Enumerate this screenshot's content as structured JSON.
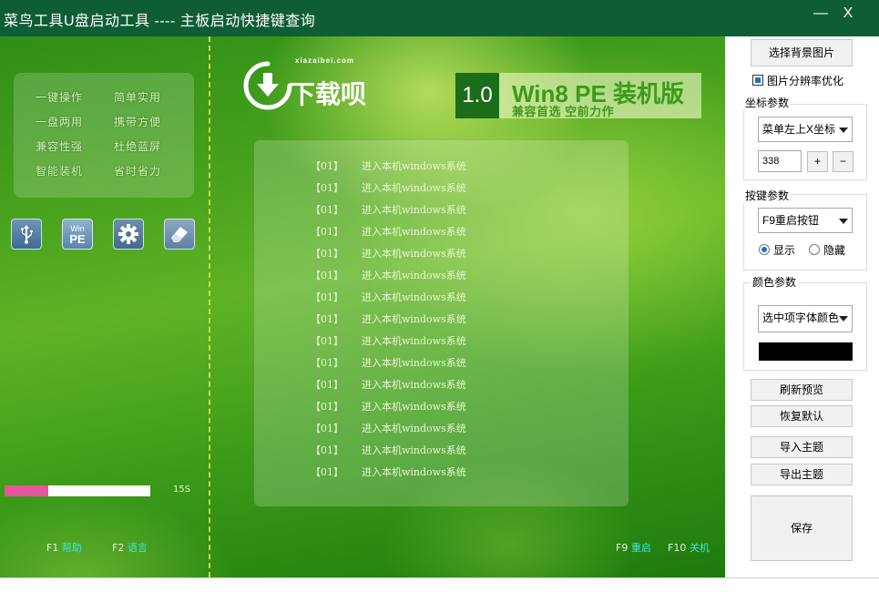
{
  "window": {
    "title": "菜鸟工具U盘启动工具 ----  主板启动快捷键查询",
    "minimize_glyph": "—",
    "close_glyph": "X"
  },
  "features": [
    "一键操作",
    "简单实用",
    "一盘两用",
    "携带方便",
    "兼容性强",
    "杜绝蓝屏",
    "智能装机",
    "省时省力"
  ],
  "icons": [
    "usb-icon",
    "winpe-icon",
    "gear-icon",
    "eraser-icon"
  ],
  "winpe_icon": {
    "top": "Win",
    "bottom": "PE"
  },
  "logo": {
    "site": "xiazaibei.com",
    "text": "下载呗"
  },
  "banner": {
    "version": "1.0",
    "title": "Win8 PE 装机版",
    "subtitle": "兼容首选 空前力作"
  },
  "menu_items": [
    {
      "num": "【01】",
      "label": "进入本机windows系统"
    },
    {
      "num": "【01】",
      "label": "进入本机windows系统"
    },
    {
      "num": "【01】",
      "label": "进入本机windows系统"
    },
    {
      "num": "【01】",
      "label": "进入本机windows系统"
    },
    {
      "num": "【01】",
      "label": "进入本机windows系统"
    },
    {
      "num": "【01】",
      "label": "进入本机windows系统"
    },
    {
      "num": "【01】",
      "label": "进入本机windows系统"
    },
    {
      "num": "【01】",
      "label": "进入本机windows系统"
    },
    {
      "num": "【01】",
      "label": "进入本机windows系统"
    },
    {
      "num": "【01】",
      "label": "进入本机windows系统"
    },
    {
      "num": "【01】",
      "label": "进入本机windows系统"
    },
    {
      "num": "【01】",
      "label": "进入本机windows系统"
    },
    {
      "num": "【01】",
      "label": "进入本机windows系统"
    },
    {
      "num": "【01】",
      "label": "进入本机windows系统"
    },
    {
      "num": "【01】",
      "label": "进入本机windows系统"
    }
  ],
  "progress": {
    "fraction": 0.3,
    "label": "15S",
    "color": "#e5559d"
  },
  "hotkeys": {
    "help": {
      "key": "F1",
      "action": "帮助"
    },
    "language": {
      "key": "F2",
      "action": "语言"
    },
    "restart": {
      "key": "F9",
      "action": "重启"
    },
    "shutdown": {
      "key": "F10",
      "action": "关机"
    }
  },
  "side": {
    "choose_bg_button": "选择背景图片",
    "image_optimize": {
      "label": "图片分辨率优化",
      "checked": true
    },
    "coord_group": {
      "title": "坐标参数",
      "select": "菜单左上X坐标",
      "value": "338",
      "plus": "+",
      "minus": "−"
    },
    "key_group": {
      "title": "按键参数",
      "select": "F9重启按钮",
      "show_label": "显示",
      "hide_label": "隐藏",
      "selected": "显示"
    },
    "color_group": {
      "title": "颜色参数",
      "select": "选中项字体颜色",
      "swatch_color": "#000000"
    },
    "refresh_button": "刷新预览",
    "restore_button": "恢复默认",
    "import_button": "导入主题",
    "export_button": "导出主题",
    "save_button": "保存"
  }
}
